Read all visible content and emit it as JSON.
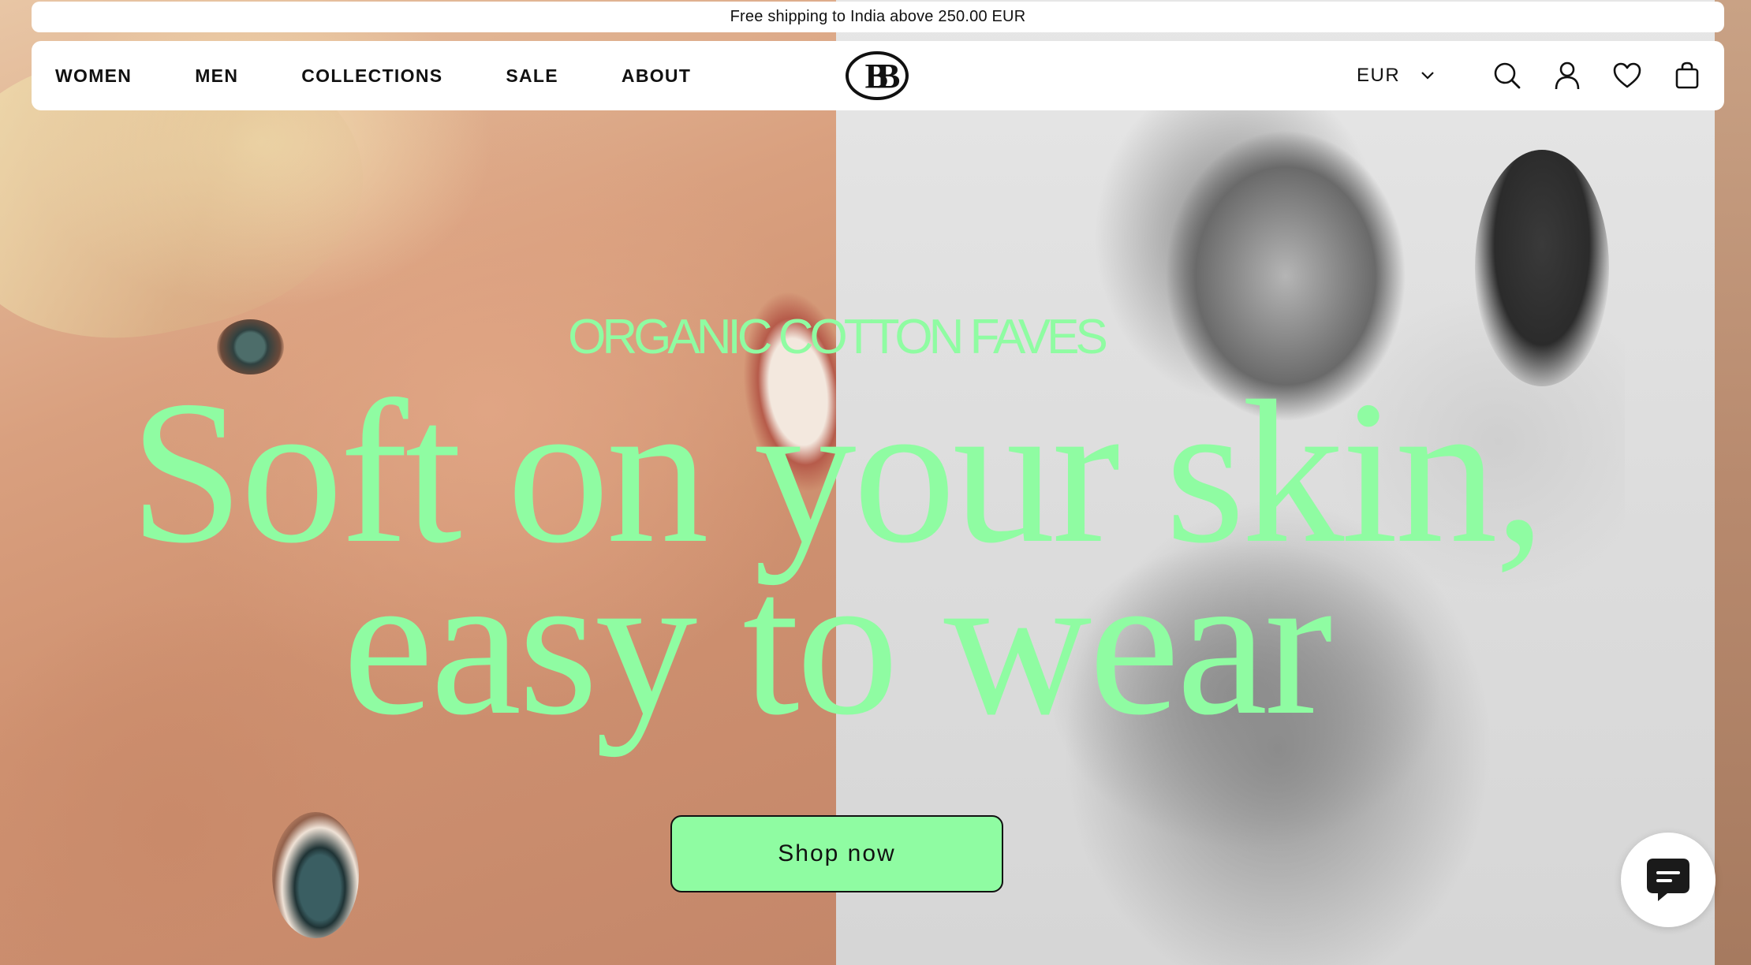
{
  "announcement": {
    "text": "Free shipping to India above 250.00 EUR"
  },
  "header": {
    "nav": [
      {
        "label": "WOMEN"
      },
      {
        "label": "MEN"
      },
      {
        "label": "COLLECTIONS"
      },
      {
        "label": "SALE"
      },
      {
        "label": "ABOUT"
      }
    ],
    "logo_icon": "bb-monogram-logo",
    "currency": {
      "selected": "EUR"
    },
    "icons": [
      "search-icon",
      "account-icon",
      "wishlist-heart-icon",
      "cart-bag-icon"
    ]
  },
  "hero": {
    "eyebrow": "ORGANIC COTTON FAVES",
    "headline_line1": "Soft on your skin,",
    "headline_line2": "easy to wear",
    "cta_label": "Shop now",
    "accent_color": "#8ffca2"
  },
  "chat": {
    "icon": "chat-icon"
  }
}
